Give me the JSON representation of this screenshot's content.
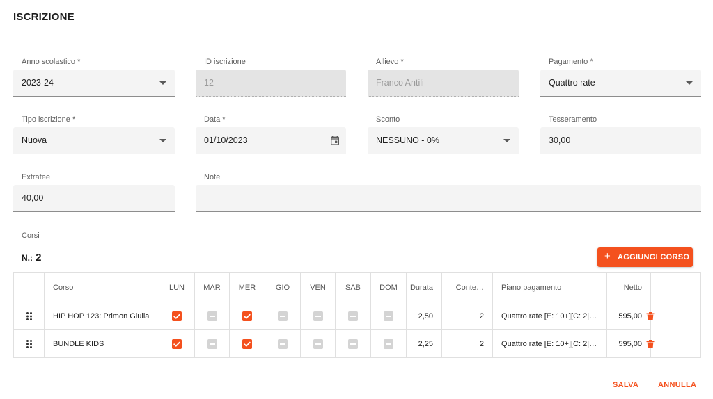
{
  "dialog": {
    "title": "ISCRIZIONE"
  },
  "form": {
    "anno_scolastico": {
      "label": "Anno scolastico *",
      "value": "2023-24"
    },
    "id_iscrizione": {
      "label": "ID iscrizione",
      "value": "12"
    },
    "allievo": {
      "label": "Allievo *",
      "value": "Franco Antili"
    },
    "pagamento": {
      "label": "Pagamento *",
      "value": "Quattro rate"
    },
    "tipo_iscrizione": {
      "label": "Tipo iscrizione *",
      "value": "Nuova"
    },
    "data": {
      "label": "Data *",
      "value": "01/10/2023"
    },
    "sconto": {
      "label": "Sconto",
      "value": "NESSUNO - 0%"
    },
    "tesseramento": {
      "label": "Tesseramento",
      "value": "30,00"
    },
    "extrafee": {
      "label": "Extrafee",
      "value": "40,00"
    },
    "note": {
      "label": "Note",
      "value": ""
    }
  },
  "corsi": {
    "label": "Corsi",
    "count_prefix": "N.:",
    "count": "2",
    "add_button": "AGGIUNGI CORSO",
    "columns": [
      "Corso",
      "LUN",
      "MAR",
      "MER",
      "GIO",
      "VEN",
      "SAB",
      "DOM",
      "Durata",
      "Conte…",
      "Piano pagamento",
      "Netto"
    ],
    "rows": [
      {
        "corso": "HIP HOP 123: Primon Giulia",
        "days": [
          true,
          false,
          true,
          false,
          false,
          false,
          false
        ],
        "durata": "2,50",
        "conte": "2",
        "piano": "Quattro rate [E: 10+][C: 2|C:…",
        "netto": "595,00"
      },
      {
        "corso": "BUNDLE KIDS",
        "days": [
          true,
          false,
          true,
          false,
          false,
          false,
          false
        ],
        "durata": "2,25",
        "conte": "2",
        "piano": "Quattro rate [E: 10+][C: 2|C:…",
        "netto": "595,00"
      }
    ]
  },
  "footer": {
    "save": "SALVA",
    "cancel": "ANNULLA"
  },
  "colors": {
    "accent": "#f4511e",
    "disabled_checkbox": "#d4d4d4"
  },
  "icons": {
    "drag": "drag-handle-icon",
    "delete": "trash-icon",
    "calendar": "calendar-icon",
    "add": "plus-icon",
    "dropdown": "caret-down-icon"
  }
}
